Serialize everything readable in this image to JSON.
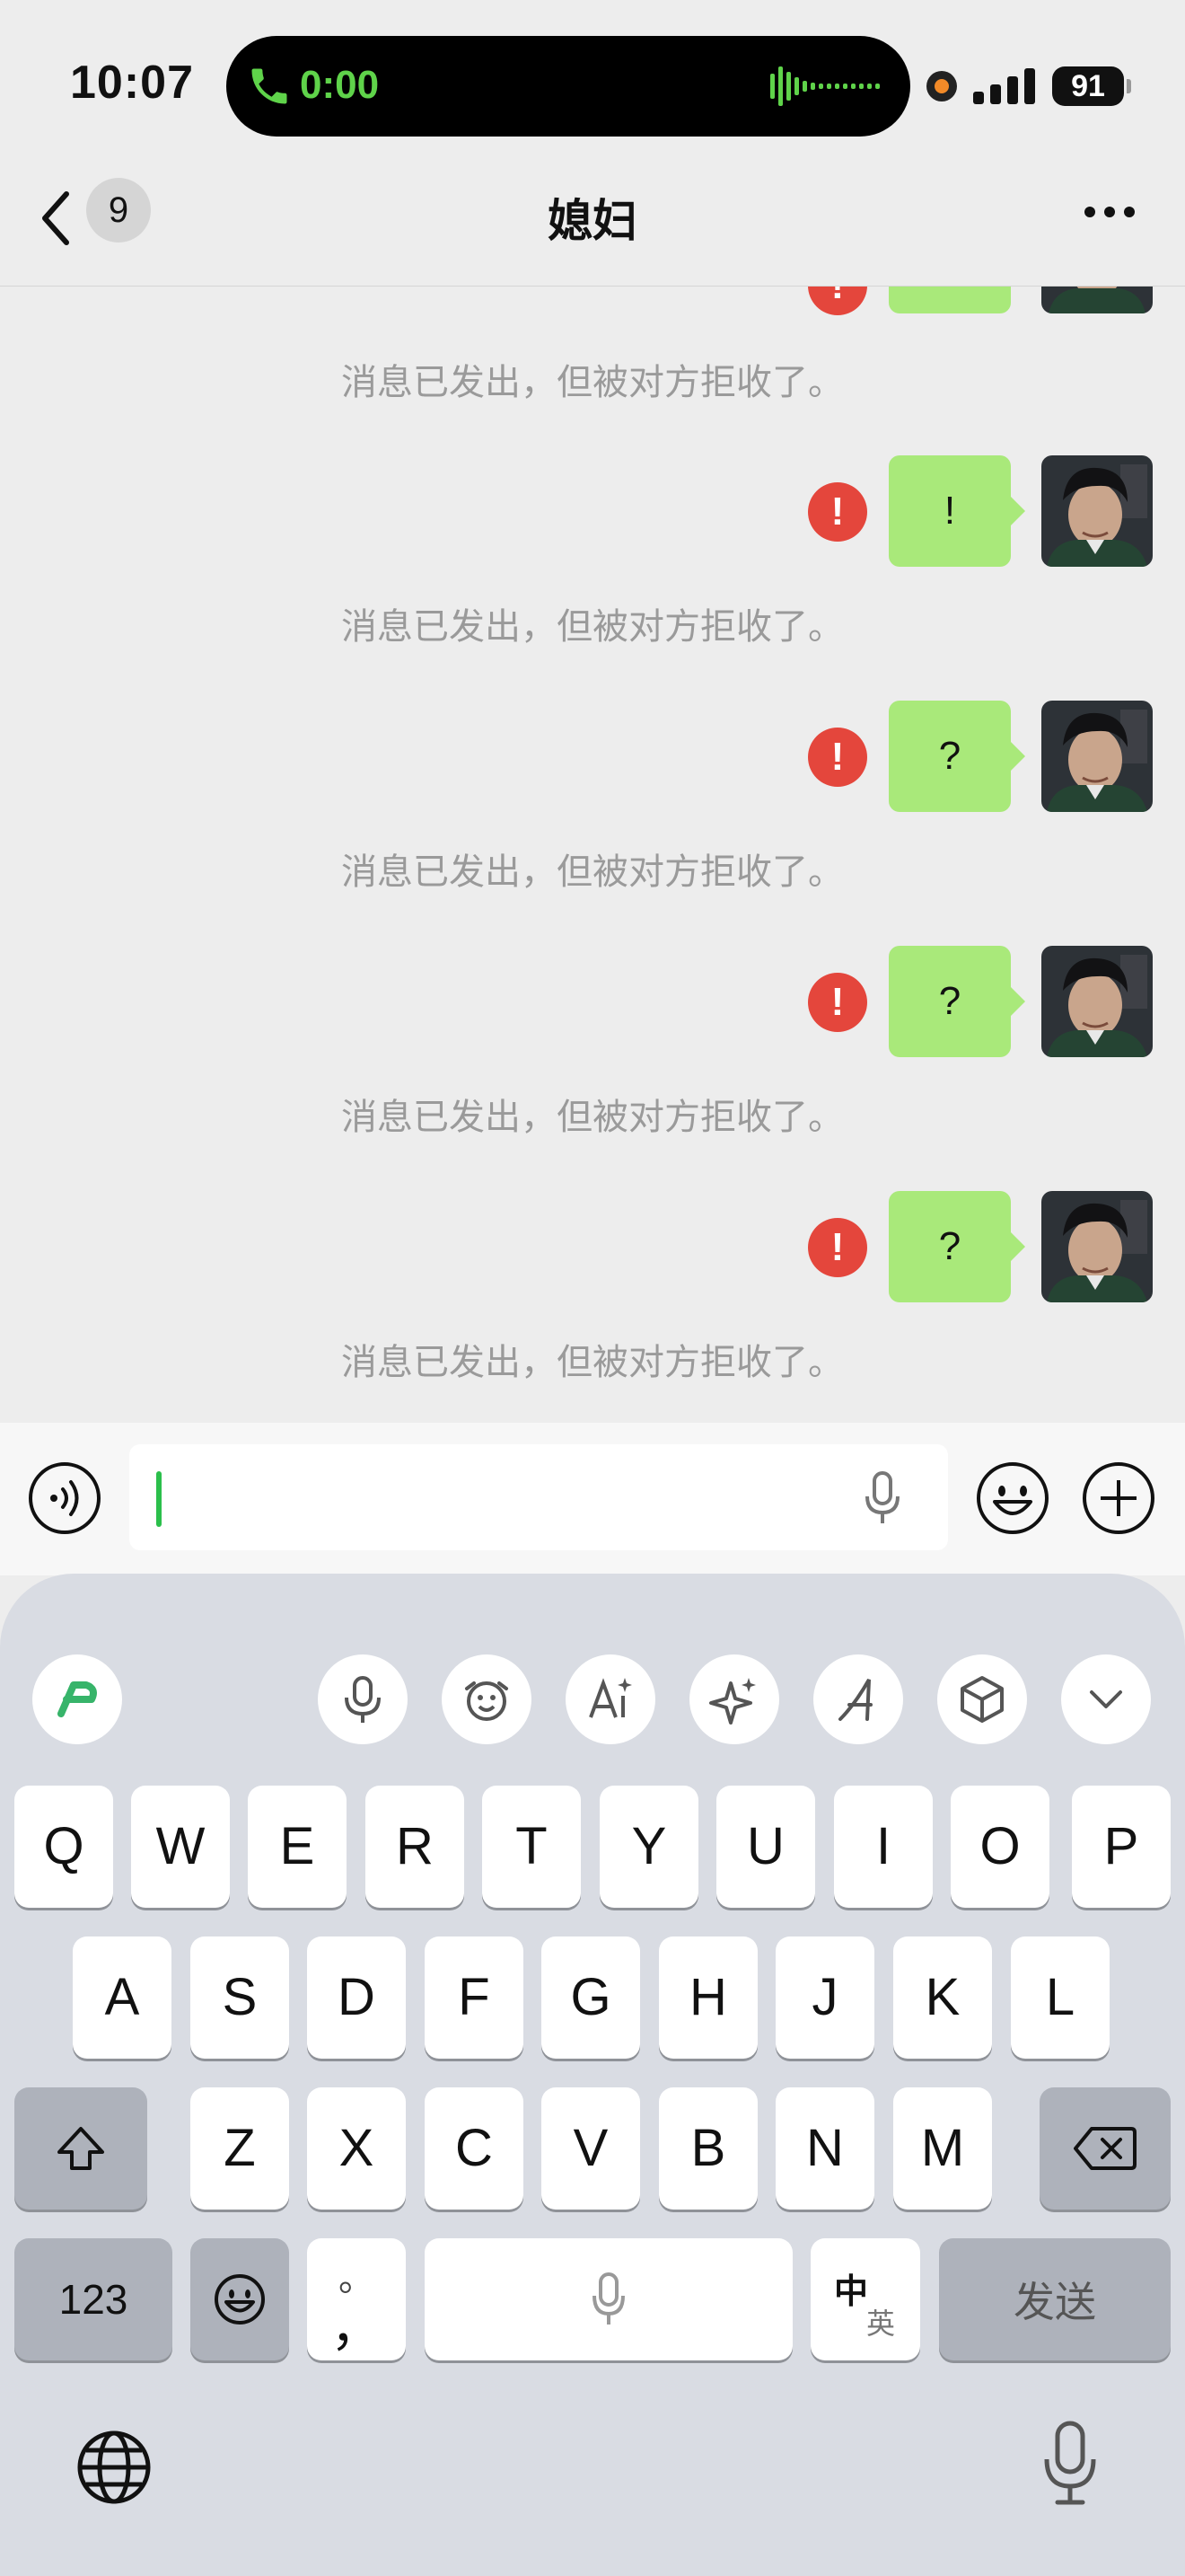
{
  "status_bar": {
    "time": "10:07",
    "call_duration": "0:00",
    "battery": "91",
    "accent_green": "#5fd34a"
  },
  "nav": {
    "back_count": "9",
    "title": "媳妇",
    "more_icon": "more-dots-icon"
  },
  "chat": {
    "bubble_color": "#a9e97a",
    "error_color": "#e4463c",
    "messages": [
      {
        "text": "!"
      },
      {
        "text": "?"
      },
      {
        "text": "?"
      },
      {
        "text": "?"
      }
    ],
    "system_note": "消息已发出，但被对方拒收了。"
  },
  "input_bar": {
    "voice_icon": "voice-mode-icon",
    "mic_icon": "mic-icon",
    "emoji_icon": "emoji-icon",
    "add_icon": "plus-icon"
  },
  "keyboard": {
    "toolbar": [
      "app-logo-icon",
      "mic-icon",
      "memoji-icon",
      "ai-text-icon",
      "sparkle-icon",
      "font-style-icon",
      "cube-icon",
      "chevron-down-icon"
    ],
    "row1": [
      "Q",
      "W",
      "E",
      "R",
      "T",
      "Y",
      "U",
      "I",
      "O",
      "P"
    ],
    "row2": [
      "A",
      "S",
      "D",
      "F",
      "G",
      "H",
      "J",
      "K",
      "L"
    ],
    "row3": [
      "Z",
      "X",
      "C",
      "V",
      "B",
      "N",
      "M"
    ],
    "numbers_key": "123",
    "punct_top": "。",
    "punct_bottom": "，",
    "lang_zh": "中",
    "lang_en": "英",
    "send_key": "发送"
  }
}
